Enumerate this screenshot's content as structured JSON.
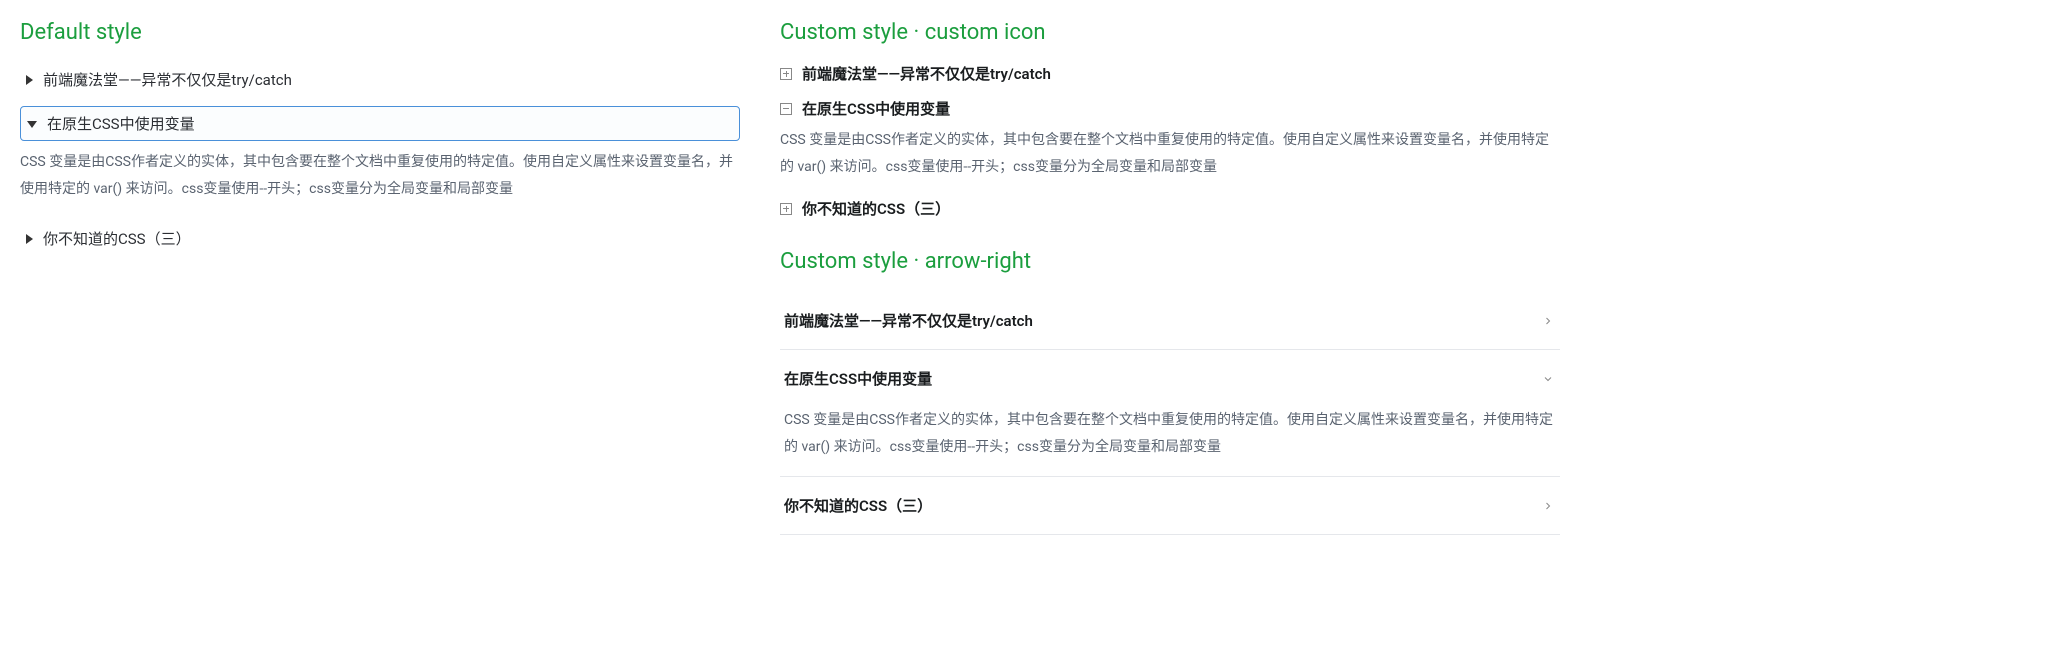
{
  "sections": {
    "default": {
      "title": "Default style",
      "items": [
        {
          "title": "前端魔法堂——异常不仅仅是try/catch",
          "open": false
        },
        {
          "title": "在原生CSS中使用变量",
          "open": true,
          "content": "CSS 变量是由CSS作者定义的实体，其中包含要在整个文档中重复使用的特定值。使用自定义属性来设置变量名，并使用特定的 var() 来访问。css变量使用--开头；css变量分为全局变量和局部变量"
        },
        {
          "title": "你不知道的CSS（三）",
          "open": false
        }
      ]
    },
    "customIcon": {
      "title": "Custom style · custom icon",
      "items": [
        {
          "title": "前端魔法堂——异常不仅仅是try/catch",
          "open": false
        },
        {
          "title": "在原生CSS中使用变量",
          "open": true,
          "content": "CSS 变量是由CSS作者定义的实体，其中包含要在整个文档中重复使用的特定值。使用自定义属性来设置变量名，并使用特定的 var() 来访问。css变量使用--开头；css变量分为全局变量和局部变量"
        },
        {
          "title": "你不知道的CSS（三）",
          "open": false
        }
      ]
    },
    "arrowRight": {
      "title": "Custom style · arrow-right",
      "items": [
        {
          "title": "前端魔法堂——异常不仅仅是try/catch",
          "open": false
        },
        {
          "title": "在原生CSS中使用变量",
          "open": true,
          "content": "CSS 变量是由CSS作者定义的实体，其中包含要在整个文档中重复使用的特定值。使用自定义属性来设置变量名，并使用特定的 var() 来访问。css变量使用--开头；css变量分为全局变量和局部变量"
        },
        {
          "title": "你不知道的CSS（三）",
          "open": false
        }
      ]
    }
  }
}
